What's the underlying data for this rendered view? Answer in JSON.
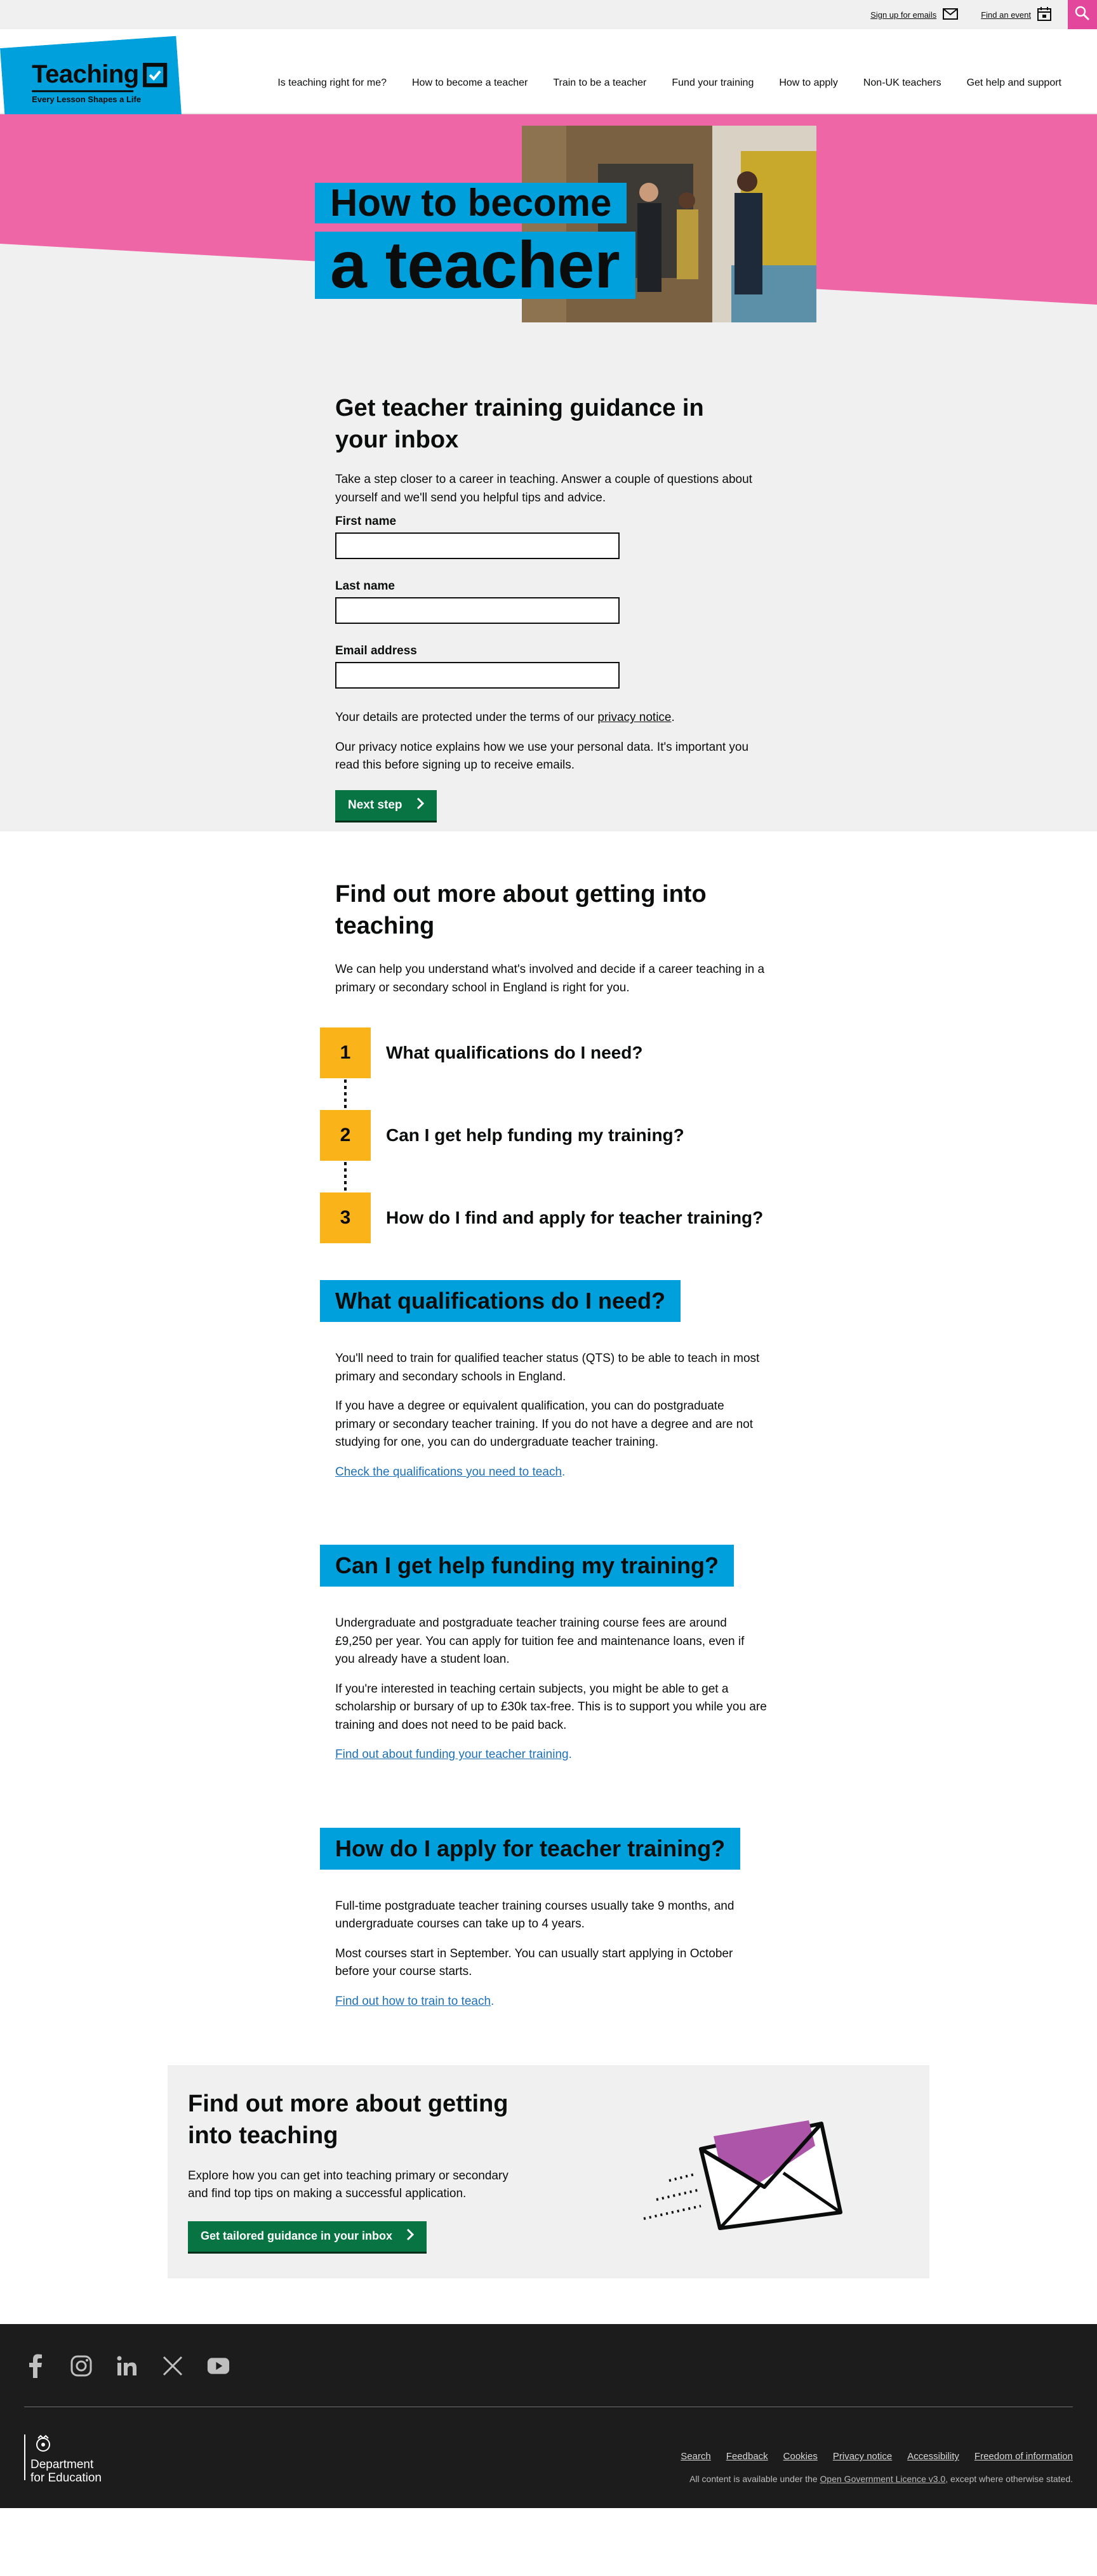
{
  "header": {
    "utility_links": [
      {
        "label": "Sign up for emails",
        "icon": "envelope-icon"
      },
      {
        "label": "Find an event",
        "icon": "calendar-icon"
      }
    ],
    "search_icon": "search-icon",
    "logo": {
      "word": "Teaching",
      "tagline": "Every Lesson Shapes a Life"
    },
    "nav": [
      "Is teaching right for me?",
      "How to become a teacher",
      "Train to be a teacher",
      "Fund your training",
      "How to apply",
      "Non-UK teachers",
      "Get help and support"
    ]
  },
  "hero": {
    "title_line1": "How to become",
    "title_line2": "a teacher",
    "photo": "people-in-school-corridor-photo"
  },
  "signup": {
    "heading": "Get teacher training guidance in your inbox",
    "intro": "Take a step closer to a career in teaching. Answer a couple of questions about yourself and we'll send you helpful tips and advice.",
    "fields": [
      {
        "label": "First name",
        "value": ""
      },
      {
        "label": "Last name",
        "value": ""
      },
      {
        "label": "Email address",
        "value": ""
      }
    ],
    "privacy_prefix": "Your details are protected under the terms of our ",
    "privacy_link": "privacy notice",
    "privacy_suffix": ".",
    "privacy_explain": "Our privacy notice explains how we use your personal data. It's important you read this before signing up to receive emails.",
    "button": "Next step"
  },
  "find_out": {
    "heading": "Find out more about getting into teaching",
    "intro": "We can help you understand what's involved and decide if a career teaching in a primary or secondary school in England is right for you.",
    "steps": [
      {
        "num": "1",
        "text": "What qualifications do I need?"
      },
      {
        "num": "2",
        "text": "Can I get help funding my training?"
      },
      {
        "num": "3",
        "text": "How do I find and apply for teacher training?"
      }
    ]
  },
  "topics": [
    {
      "heading": "What qualifications do I need?",
      "paras": [
        "You'll need to train for qualified teacher status (QTS) to be able to teach in most primary and secondary schools in England.",
        "If you have a degree or equivalent qualification, you can do postgraduate primary or secondary teacher training. If you do not have a degree and are not studying for one, you can do undergraduate teacher training."
      ],
      "link": "Check the qualifications you need to teach"
    },
    {
      "heading": "Can I get help funding my training?",
      "paras": [
        "Undergraduate and postgraduate teacher training course fees are around £9,250 per year. You can apply for tuition fee and maintenance loans, even if you already have a student loan.",
        "If you're interested in teaching certain subjects, you might be able to get a scholarship or bursary of up to £30k tax-free. This is to support you while you are training and does not need to be paid back."
      ],
      "link": "Find out about funding your teacher training"
    },
    {
      "heading": "How do I apply for teacher training?",
      "paras": [
        "Full-time postgraduate teacher training courses usually take 9 months, and undergraduate courses can take up to 4 years.",
        "Most courses start in September. You can usually start applying in October before your course starts."
      ],
      "link": "Find out how to train to teach"
    }
  ],
  "cta": {
    "heading": "Find out more about getting into teaching",
    "text": "Explore how you can get into teaching primary or secondary and find top tips on making a successful application.",
    "button": "Get tailored guidance in your inbox",
    "illustration": "flying-envelope-icon"
  },
  "footer": {
    "social": [
      "facebook-icon",
      "instagram-icon",
      "linkedin-icon",
      "x-icon",
      "youtube-icon"
    ],
    "dept_line1": "Department",
    "dept_line2": "for Education",
    "links": [
      "Search",
      "Feedback",
      "Cookies",
      "Privacy notice",
      "Accessibility",
      "Freedom of information"
    ],
    "licence_prefix": "All content is available under the ",
    "licence_link": "Open Government Licence v3.0",
    "licence_suffix": ", except where otherwise stated."
  },
  "colors": {
    "brand_blue": "#00a0dc",
    "pink": "#ef66a6",
    "button_green": "#087443",
    "step_yellow": "#fbb31a",
    "footer_dark": "#1c1c1c"
  }
}
